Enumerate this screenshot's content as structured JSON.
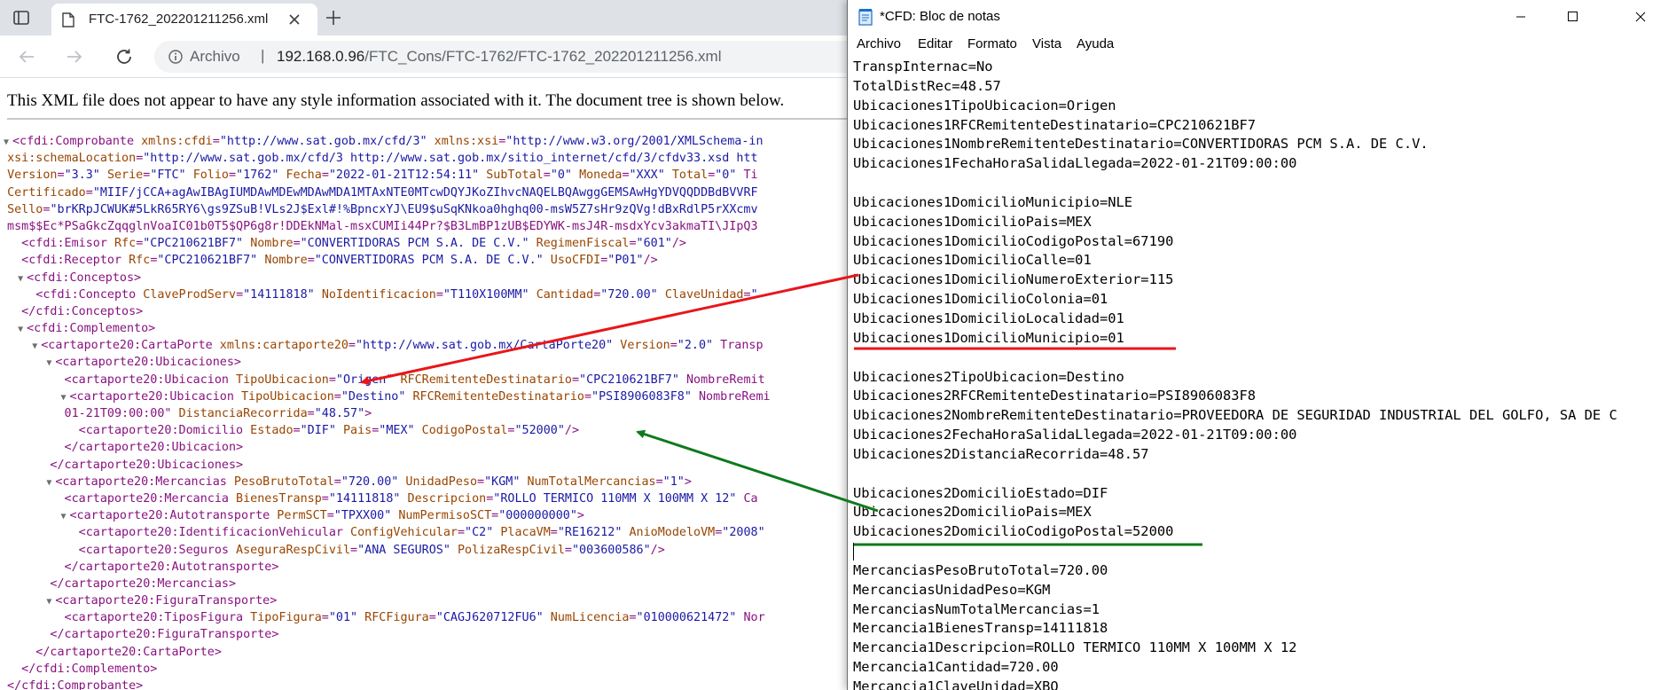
{
  "browser": {
    "tab_title": "FTC-1762_202201211256.xml",
    "omnibox_label": "Archivo",
    "omnibox_separator": "|",
    "url_host": "192.168.0.96",
    "url_path": "/FTC_Cons/FTC-1762/FTC-1762_202201211256.xml",
    "notice": "This XML file does not appear to have any style information associated with it. The document tree is shown below.",
    "xml_lines": [
      {
        "t": "▼",
        "p": "<cfdi:Comprobante xmlns:cfdi=\"http://www.sat.gob.mx/cfd/3\" xmlns:xsi=\"http://www.w3.org/2001/XMLSchema-in"
      },
      {
        "t": "",
        "p": " xsi:schemaLocation=\"http://www.sat.gob.mx/cfd/3 http://www.sat.gob.mx/sitio_internet/cfd/3/cfdv33.xsd htt"
      },
      {
        "t": "",
        "p": " Version=\"3.3\" Serie=\"FTC\" Folio=\"1762\" Fecha=\"2022-01-21T12:54:11\" SubTotal=\"0\" Moneda=\"XXX\" Total=\"0\" Ti"
      },
      {
        "t": "",
        "p": " Certificado=\"MIIF/jCCA+agAwIBAgIUMDAwMDEwMDAwMDA1MTAxNTE0MTcwDQYJKoZIhvcNAQELBQAwggGEMSAwHgYDVQQDDBdBVVRF"
      },
      {
        "t": "",
        "p": " Sello=\"brKRpJCWUK#5LkR65RY6\\gs9ZSuB!VLs2J$Exl#!%BpncxYJ\\EU9$uSqKNkoa0hghq00-msW5Z7sHr9zQVg!dBxRdlP5rXXcmv"
      },
      {
        "t": "",
        "p": " msm$$Ec*PSaGkcZqqglnVoaIC01b0T5$QP6g8r!DDEkNMal-msxCUMIi44Pr?$B3LmBP1zUB$EDYWK-msJ4R-msdxYcv3akmaTI\\JIpQ3"
      },
      {
        "t": "",
        "p": "   <cfdi:Emisor Rfc=\"CPC210621BF7\" Nombre=\"CONVERTIDORAS PCM S.A. DE C.V.\" RegimenFiscal=\"601\"/>"
      },
      {
        "t": "",
        "p": "   <cfdi:Receptor Rfc=\"CPC210621BF7\" Nombre=\"CONVERTIDORAS PCM S.A. DE C.V.\" UsoCFDI=\"P01\"/>"
      },
      {
        "t": "  ▼",
        "p": "<cfdi:Conceptos>"
      },
      {
        "t": "",
        "p": "     <cfdi:Concepto ClaveProdServ=\"14111818\" NoIdentificacion=\"T110X100MM\" Cantidad=\"720.00\" ClaveUnidad=\""
      },
      {
        "t": "",
        "p": "   </cfdi:Conceptos>"
      },
      {
        "t": "  ▼",
        "p": "<cfdi:Complemento>"
      },
      {
        "t": "    ▼",
        "p": "<cartaporte20:CartaPorte xmlns:cartaporte20=\"http://www.sat.gob.mx/CartaPorte20\" Version=\"2.0\" Transp"
      },
      {
        "t": "      ▼",
        "p": "<cartaporte20:Ubicaciones>"
      },
      {
        "t": "",
        "p": "         <cartaporte20:Ubicacion TipoUbicacion=\"Origen\" RFCRemitenteDestinatario=\"CPC210621BF7\" NombreRemit"
      },
      {
        "t": "        ▼",
        "p": "<cartaporte20:Ubicacion TipoUbicacion=\"Destino\" RFCRemitenteDestinatario=\"PSI8906083F8\" NombreRemi"
      },
      {
        "t": "",
        "p": "         01-21T09:00:00\" DistanciaRecorrida=\"48.57\">"
      },
      {
        "t": "",
        "p": "           <cartaporte20:Domicilio Estado=\"DIF\" Pais=\"MEX\" CodigoPostal=\"52000\"/>"
      },
      {
        "t": "",
        "p": "         </cartaporte20:Ubicacion>"
      },
      {
        "t": "",
        "p": "       </cartaporte20:Ubicaciones>"
      },
      {
        "t": "      ▼",
        "p": "<cartaporte20:Mercancias PesoBrutoTotal=\"720.00\" UnidadPeso=\"KGM\" NumTotalMercancias=\"1\">"
      },
      {
        "t": "",
        "p": "         <cartaporte20:Mercancia BienesTransp=\"14111818\" Descripcion=\"ROLLO TERMICO 110MM X 100MM X 12\" Ca"
      },
      {
        "t": "        ▼",
        "p": "<cartaporte20:Autotransporte PermSCT=\"TPXX00\" NumPermisoSCT=\"000000000\">"
      },
      {
        "t": "",
        "p": "           <cartaporte20:IdentificacionVehicular ConfigVehicular=\"C2\" PlacaVM=\"RE16212\" AnioModeloVM=\"2008\""
      },
      {
        "t": "",
        "p": "           <cartaporte20:Seguros AseguraRespCivil=\"ANA SEGUROS\" PolizaRespCivil=\"003600586\"/>"
      },
      {
        "t": "",
        "p": "         </cartaporte20:Autotransporte>"
      },
      {
        "t": "",
        "p": "       </cartaporte20:Mercancias>"
      },
      {
        "t": "      ▼",
        "p": "<cartaporte20:FiguraTransporte>"
      },
      {
        "t": "",
        "p": "         <cartaporte20:TiposFigura TipoFigura=\"01\" RFCFigura=\"CAGJ620712FU6\" NumLicencia=\"010000621472\" Nor"
      },
      {
        "t": "",
        "p": "       </cartaporte20:FiguraTransporte>"
      },
      {
        "t": "",
        "p": "     </cartaporte20:CartaPorte>"
      },
      {
        "t": "",
        "p": "   </cfdi:Complemento>"
      },
      {
        "t": "",
        "p": " </cfdi:Comprobante>"
      }
    ]
  },
  "notepad": {
    "title": "*CFD: Bloc de notas",
    "menu": [
      "Archivo",
      "Editar",
      "Formato",
      "Vista",
      "Ayuda"
    ],
    "lines": [
      "TranspInternac=No",
      "TotalDistRec=48.57",
      "Ubicaciones1TipoUbicacion=Origen",
      "Ubicaciones1RFCRemitenteDestinatario=CPC210621BF7",
      "Ubicaciones1NombreRemitenteDestinatario=CONVERTIDORAS PCM S.A. DE C.V.",
      "Ubicaciones1FechaHoraSalidaLlegada=2022-01-21T09:00:00",
      "",
      "Ubicaciones1DomicilioMunicipio=NLE",
      "Ubicaciones1DomicilioPais=MEX",
      "Ubicaciones1DomicilioCodigoPostal=67190",
      "Ubicaciones1DomicilioCalle=01",
      "Ubicaciones1DomicilioNumeroExterior=115",
      "Ubicaciones1DomicilioColonia=01",
      "Ubicaciones1DomicilioLocalidad=01",
      "Ubicaciones1DomicilioMunicipio=01",
      "",
      "Ubicaciones2TipoUbicacion=Destino",
      "Ubicaciones2RFCRemitenteDestinatario=PSI8906083F8",
      "Ubicaciones2NombreRemitenteDestinatario=PROVEEDORA DE SEGURIDAD INDUSTRIAL DEL GOLFO, SA DE C",
      "Ubicaciones2FechaHoraSalidaLlegada=2022-01-21T09:00:00",
      "Ubicaciones2DistanciaRecorrida=48.57",
      "",
      "Ubicaciones2DomicilioEstado=DIF",
      "Ubicaciones2DomicilioPais=MEX",
      "Ubicaciones2DomicilioCodigoPostal=52000",
      "",
      "MercanciasPesoBrutoTotal=720.00",
      "MercanciasUnidadPeso=KGM",
      "MercanciasNumTotalMercancias=1",
      "Mercancia1BienesTransp=14111818",
      "Mercancia1Descripcion=ROLLO TERMICO 110MM X 100MM X 12",
      "Mercancia1Cantidad=720.00",
      "Mercancia1ClaveUnidad=XBO"
    ]
  },
  "colors": {
    "red_annotation": "#e8161b",
    "green_annotation": "#0f7a1c",
    "xml_tag": "#881280",
    "xml_attr_name": "#994500",
    "xml_attr_value": "#1a1aa6"
  },
  "icons": {
    "sidebar": "sidebar-icon",
    "document": "document-icon",
    "close": "close-icon",
    "new_tab": "plus-icon",
    "back": "back-arrow-icon",
    "forward": "forward-arrow-icon",
    "reload": "reload-icon",
    "info": "info-icon",
    "notepad": "notepad-icon",
    "minimize": "minimize-icon",
    "maximize": "maximize-icon"
  }
}
